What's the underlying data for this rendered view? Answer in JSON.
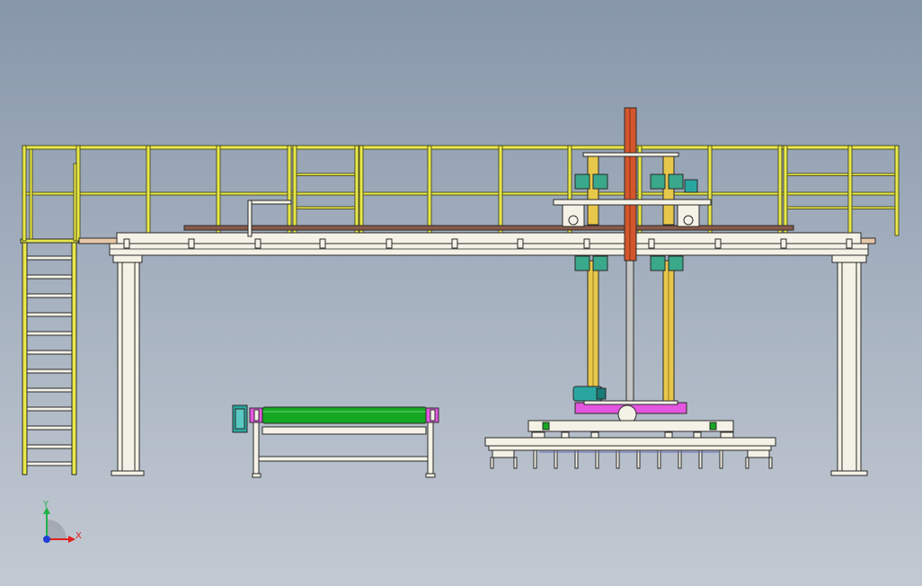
{
  "triad": {
    "x_label": "X",
    "y_label": "Y",
    "x_color": "#e0201c",
    "y_color": "#21b14a",
    "z_color": "#1f3fd6"
  },
  "colors": {
    "background_top": "#8797aa",
    "background_bottom": "#c2c9d2",
    "railing": "#e8e84a",
    "column": "#f4f2e6",
    "mast": "#d4562c",
    "roller": "#16a822",
    "base_plate": "#e455e0",
    "motor": "#2aa6a0",
    "rod": "#b8b8b8"
  },
  "parts": [
    "access-ladder",
    "walkway-platform",
    "guard-railing",
    "support-column-left",
    "support-column-right",
    "lift-mast",
    "guide-posts",
    "carriage",
    "roller-conveyor",
    "drive-motor",
    "gripper-head",
    "gripper-frame"
  ]
}
